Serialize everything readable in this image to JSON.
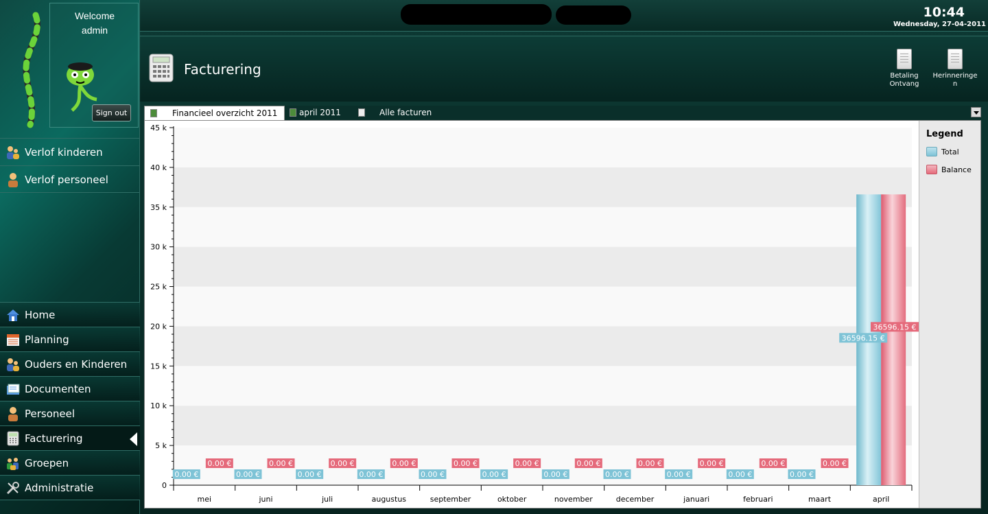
{
  "header": {
    "time": "10:44",
    "date": "Wednesday, 27-04-2011"
  },
  "user": {
    "welcome": "Welcome",
    "name": "admin",
    "signout_label": "Sign out"
  },
  "sidebar": {
    "top_items": [
      {
        "label": "Verlof kinderen",
        "icon": "parents-children-icon"
      },
      {
        "label": "Verlof personeel",
        "icon": "person-icon"
      }
    ],
    "items": [
      {
        "label": "Home",
        "icon": "home-icon"
      },
      {
        "label": "Planning",
        "icon": "calendar-icon"
      },
      {
        "label": "Ouders en Kinderen",
        "icon": "parents-children-icon"
      },
      {
        "label": "Documenten",
        "icon": "documents-icon"
      },
      {
        "label": "Personeel",
        "icon": "person-icon"
      },
      {
        "label": "Facturering",
        "icon": "calculator-icon",
        "active": true
      },
      {
        "label": "Groepen",
        "icon": "groups-icon"
      },
      {
        "label": "Administratie",
        "icon": "tools-icon"
      }
    ]
  },
  "page": {
    "title": "Facturering",
    "actions": [
      {
        "label_line1": "Betaling",
        "label_line2": "Ontvang"
      },
      {
        "label_line1": "Herinneringe",
        "label_line2": "n"
      }
    ]
  },
  "tabs": [
    {
      "label": "Financieel overzicht 2011",
      "active": true
    },
    {
      "label": "april 2011",
      "active": false
    },
    {
      "label": "Alle facturen",
      "active": false
    }
  ],
  "legend": {
    "title": "Legend"
  },
  "colors": {
    "total": "#7ec3d6",
    "balance": "#e56a7b"
  },
  "chart_data": {
    "type": "bar",
    "categories": [
      "mei",
      "juni",
      "juli",
      "augustus",
      "september",
      "oktober",
      "november",
      "december",
      "januari",
      "februari",
      "maart",
      "april"
    ],
    "series": [
      {
        "name": "Total",
        "values": [
          0,
          0,
          0,
          0,
          0,
          0,
          0,
          0,
          0,
          0,
          0,
          36596.15
        ],
        "labels": [
          "0.00 €",
          "0.00 €",
          "0.00 €",
          "0.00 €",
          "0.00 €",
          "0.00 €",
          "0.00 €",
          "0.00 €",
          "0.00 €",
          "0.00 €",
          "0.00 €",
          "36596.15 €"
        ]
      },
      {
        "name": "Balance",
        "values": [
          0,
          0,
          0,
          0,
          0,
          0,
          0,
          0,
          0,
          0,
          0,
          36596.15
        ],
        "labels": [
          "0.00 €",
          "0.00 €",
          "0.00 €",
          "0.00 €",
          "0.00 €",
          "0.00 €",
          "0.00 €",
          "0.00 €",
          "0.00 €",
          "0.00 €",
          "0.00 €",
          "36596.15 €"
        ]
      }
    ],
    "yticks": [
      0,
      5000,
      10000,
      15000,
      20000,
      25000,
      30000,
      35000,
      40000,
      45000
    ],
    "ytick_labels": [
      "0",
      "5 k",
      "10 k",
      "15 k",
      "20 k",
      "25 k",
      "30 k",
      "35 k",
      "40 k",
      "45 k"
    ],
    "ylim": [
      0,
      45000
    ],
    "grid": "alternating bands",
    "legend_position": "right"
  }
}
